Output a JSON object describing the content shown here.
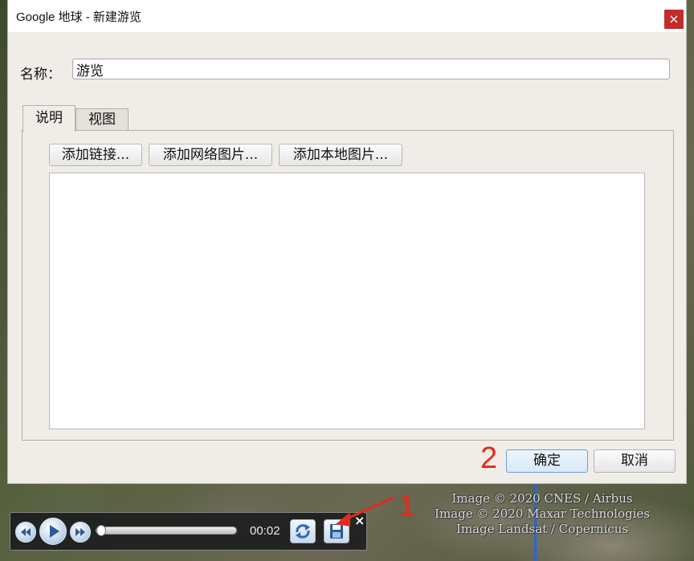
{
  "window": {
    "title": "Google 地球  -  新建游览",
    "close_symbol": "×"
  },
  "form": {
    "name_label": "名称：",
    "name_value": "游览"
  },
  "tabs": [
    {
      "label": "说明",
      "active": true
    },
    {
      "label": "视图",
      "active": false
    }
  ],
  "description_toolbar": {
    "add_link": "添加链接...",
    "add_web_image": "添加网络图片...",
    "add_local_image": "添加本地图片..."
  },
  "description_text": "",
  "footer": {
    "ok_label": "确定",
    "cancel_label": "取消"
  },
  "annotations": {
    "marker_1": "1",
    "marker_2": "2",
    "color": "#e52a1c"
  },
  "tour_player": {
    "time": "00:02",
    "progress": 0.0,
    "close_symbol": "×",
    "icons": [
      "rewind-icon",
      "play-icon",
      "fast-forward-icon",
      "repeat-icon",
      "save-icon"
    ]
  },
  "map_credits": [
    "Image © 2020 CNES / Airbus",
    "Image © 2020 Maxar Technologies",
    "Image Landsat / Copernicus"
  ]
}
